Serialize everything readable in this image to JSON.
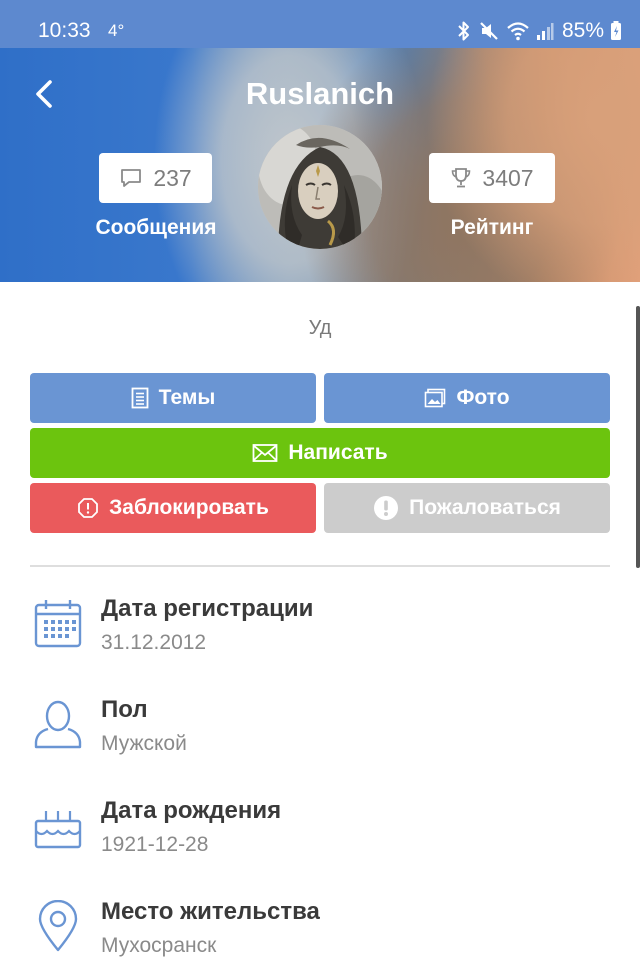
{
  "statusbar": {
    "time": "10:33",
    "temperature": "4°",
    "battery": "85%",
    "icons": [
      "bluetooth-icon",
      "mute-icon",
      "wifi-icon",
      "signal-icon",
      "battery-charging-icon"
    ]
  },
  "header": {
    "name": "Ruslanich",
    "messages": {
      "count": "237",
      "label": "Сообщения",
      "icon": "speech-bubble-icon"
    },
    "rating": {
      "count": "3407",
      "label": "Рейтинг",
      "icon": "trophy-icon"
    }
  },
  "profile": {
    "status": "Уд"
  },
  "buttons": {
    "topics": "Темы",
    "photo": "Фото",
    "write": "Написать",
    "block": "Заблокировать",
    "report": "Пожаловаться"
  },
  "colors": {
    "primary_button": "#6a95d3",
    "write_button": "#6cc40e",
    "block_button": "#ea5a5c",
    "report_button": "#cccccc",
    "icon_blue": "#6a95d3"
  },
  "info": [
    {
      "label": "Дата регистрации",
      "value": "31.12.2012",
      "icon": "calendar-icon"
    },
    {
      "label": "Пол",
      "value": "Мужской",
      "icon": "person-icon"
    },
    {
      "label": "Дата рождения",
      "value": "1921-12-28",
      "icon": "birthday-cake-icon"
    },
    {
      "label": "Место жительства",
      "value": "Мухосранск",
      "icon": "location-pin-icon"
    }
  ]
}
